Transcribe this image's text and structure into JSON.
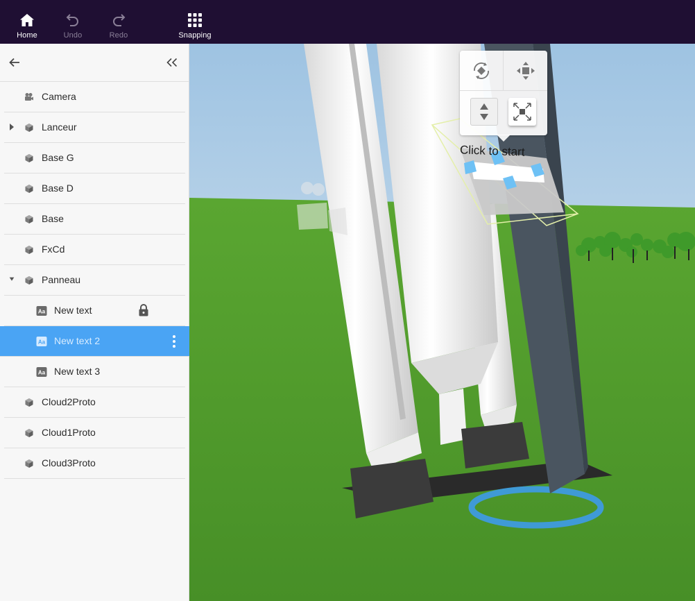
{
  "toolbar": {
    "home_label": "Home",
    "undo_label": "Undo",
    "redo_label": "Redo",
    "snapping_label": "Snapping"
  },
  "sidebar": {
    "items": [
      {
        "label": "Camera",
        "icon": "camera-icon"
      },
      {
        "label": "Lanceur",
        "icon": "cube-icon",
        "expander": "collapsed"
      },
      {
        "label": "Base G",
        "icon": "cube-icon"
      },
      {
        "label": "Base D",
        "icon": "cube-icon"
      },
      {
        "label": "Base",
        "icon": "cube-icon"
      },
      {
        "label": "FxCd",
        "icon": "cube-icon"
      },
      {
        "label": "Panneau",
        "icon": "cube-icon",
        "expander": "expanded"
      },
      {
        "label": "New text",
        "icon": "text-icon",
        "locked": true
      },
      {
        "label": "New text 2",
        "icon": "text-icon",
        "selected": true
      },
      {
        "label": "New text 3",
        "icon": "text-icon"
      },
      {
        "label": "Cloud2Proto",
        "icon": "cube-icon"
      },
      {
        "label": "Cloud1Proto",
        "icon": "cube-icon"
      },
      {
        "label": "Cloud3Proto",
        "icon": "cube-icon"
      }
    ]
  },
  "viewport": {
    "scene_text": "Click to start",
    "gizmo_modes": [
      "rotate",
      "move",
      "move-vertical",
      "scale"
    ]
  },
  "colors": {
    "toolbar_bg": "#1f0f33",
    "selection": "#4aa4f4",
    "sky": "#b7d4ea",
    "grass": "#4f9a2c"
  }
}
